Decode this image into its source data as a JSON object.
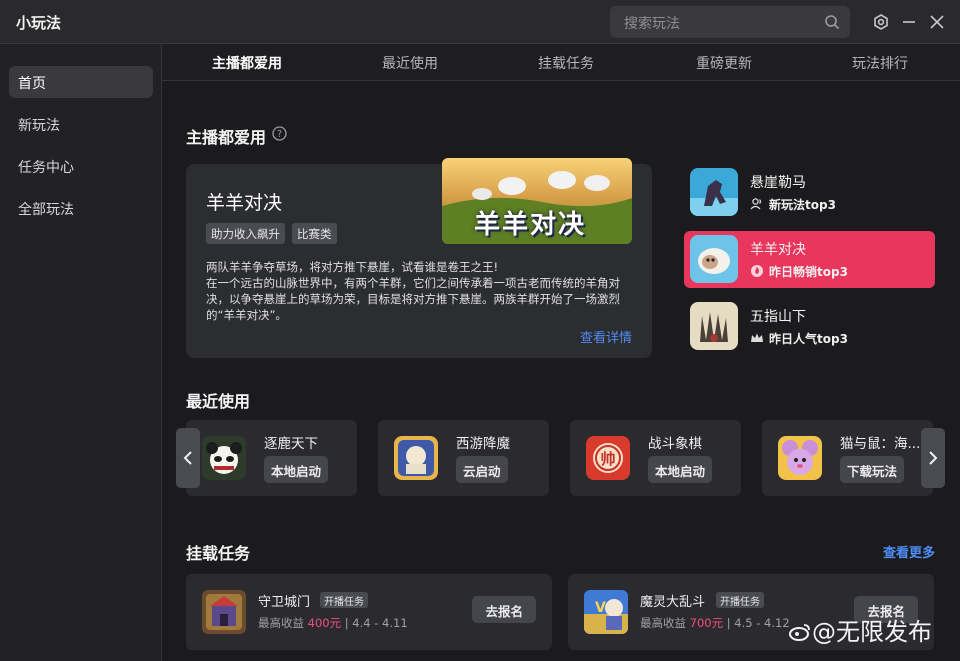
{
  "app": {
    "title": "小玩法"
  },
  "search": {
    "placeholder": "搜索玩法"
  },
  "sidebar": {
    "items": [
      {
        "label": "首页"
      },
      {
        "label": "新玩法"
      },
      {
        "label": "任务中心"
      },
      {
        "label": "全部玩法"
      }
    ]
  },
  "tabs": [
    {
      "label": "主播都爱用"
    },
    {
      "label": "最近使用"
    },
    {
      "label": "挂载任务"
    },
    {
      "label": "重磅更新"
    },
    {
      "label": "玩法排行"
    }
  ],
  "popular": {
    "section_title": "主播都爱用",
    "feature": {
      "title": "羊羊对决",
      "tags": [
        "助力收入飙升",
        "比赛类"
      ],
      "banner_text": "羊羊对决",
      "desc": "两队羊羊争夺草场，将对方推下悬崖，试看谁是卷王之王!\n在一个远古的山脉世界中，有两个羊群，它们之间传承着一项古老而传统的羊角对决，以争夺悬崖上的草场为荣，目标是将对方推下悬崖。两族羊群开始了一场激烈的“羊羊对决”。",
      "link": "查看详情"
    },
    "ranks": [
      {
        "name": "悬崖勒马",
        "sub": "新玩法top3"
      },
      {
        "name": "羊羊对决",
        "sub": "昨日畅销top3"
      },
      {
        "name": "五指山下",
        "sub": "昨日人气top3"
      }
    ]
  },
  "recent": {
    "section_title": "最近使用",
    "items": [
      {
        "name": "逐鹿天下",
        "button": "本地启动"
      },
      {
        "name": "西游降魔",
        "button": "云启动"
      },
      {
        "name": "战斗象棋",
        "button": "本地启动"
      },
      {
        "name": "猫与鼠：海...",
        "button": "下载玩法"
      }
    ]
  },
  "tasks": {
    "section_title": "挂载任务",
    "more": "查看更多",
    "items": [
      {
        "name": "守卫城门",
        "badge": "开播任务",
        "income_label": "最高收益",
        "income": "400元",
        "sep": "|",
        "dates": "4.4 - 4.11",
        "button": "去报名"
      },
      {
        "name": "魔灵大乱斗",
        "badge": "开播任务",
        "income_label": "最高收益",
        "income": "700元",
        "sep": "|",
        "dates": "4.5 - 4.12",
        "button": "去报名"
      }
    ]
  },
  "watermark": {
    "text": "@无限发布"
  },
  "colors": {
    "accent_pink": "#e8365d",
    "link_blue": "#4f8cf5",
    "income_red": "#f0507a"
  }
}
